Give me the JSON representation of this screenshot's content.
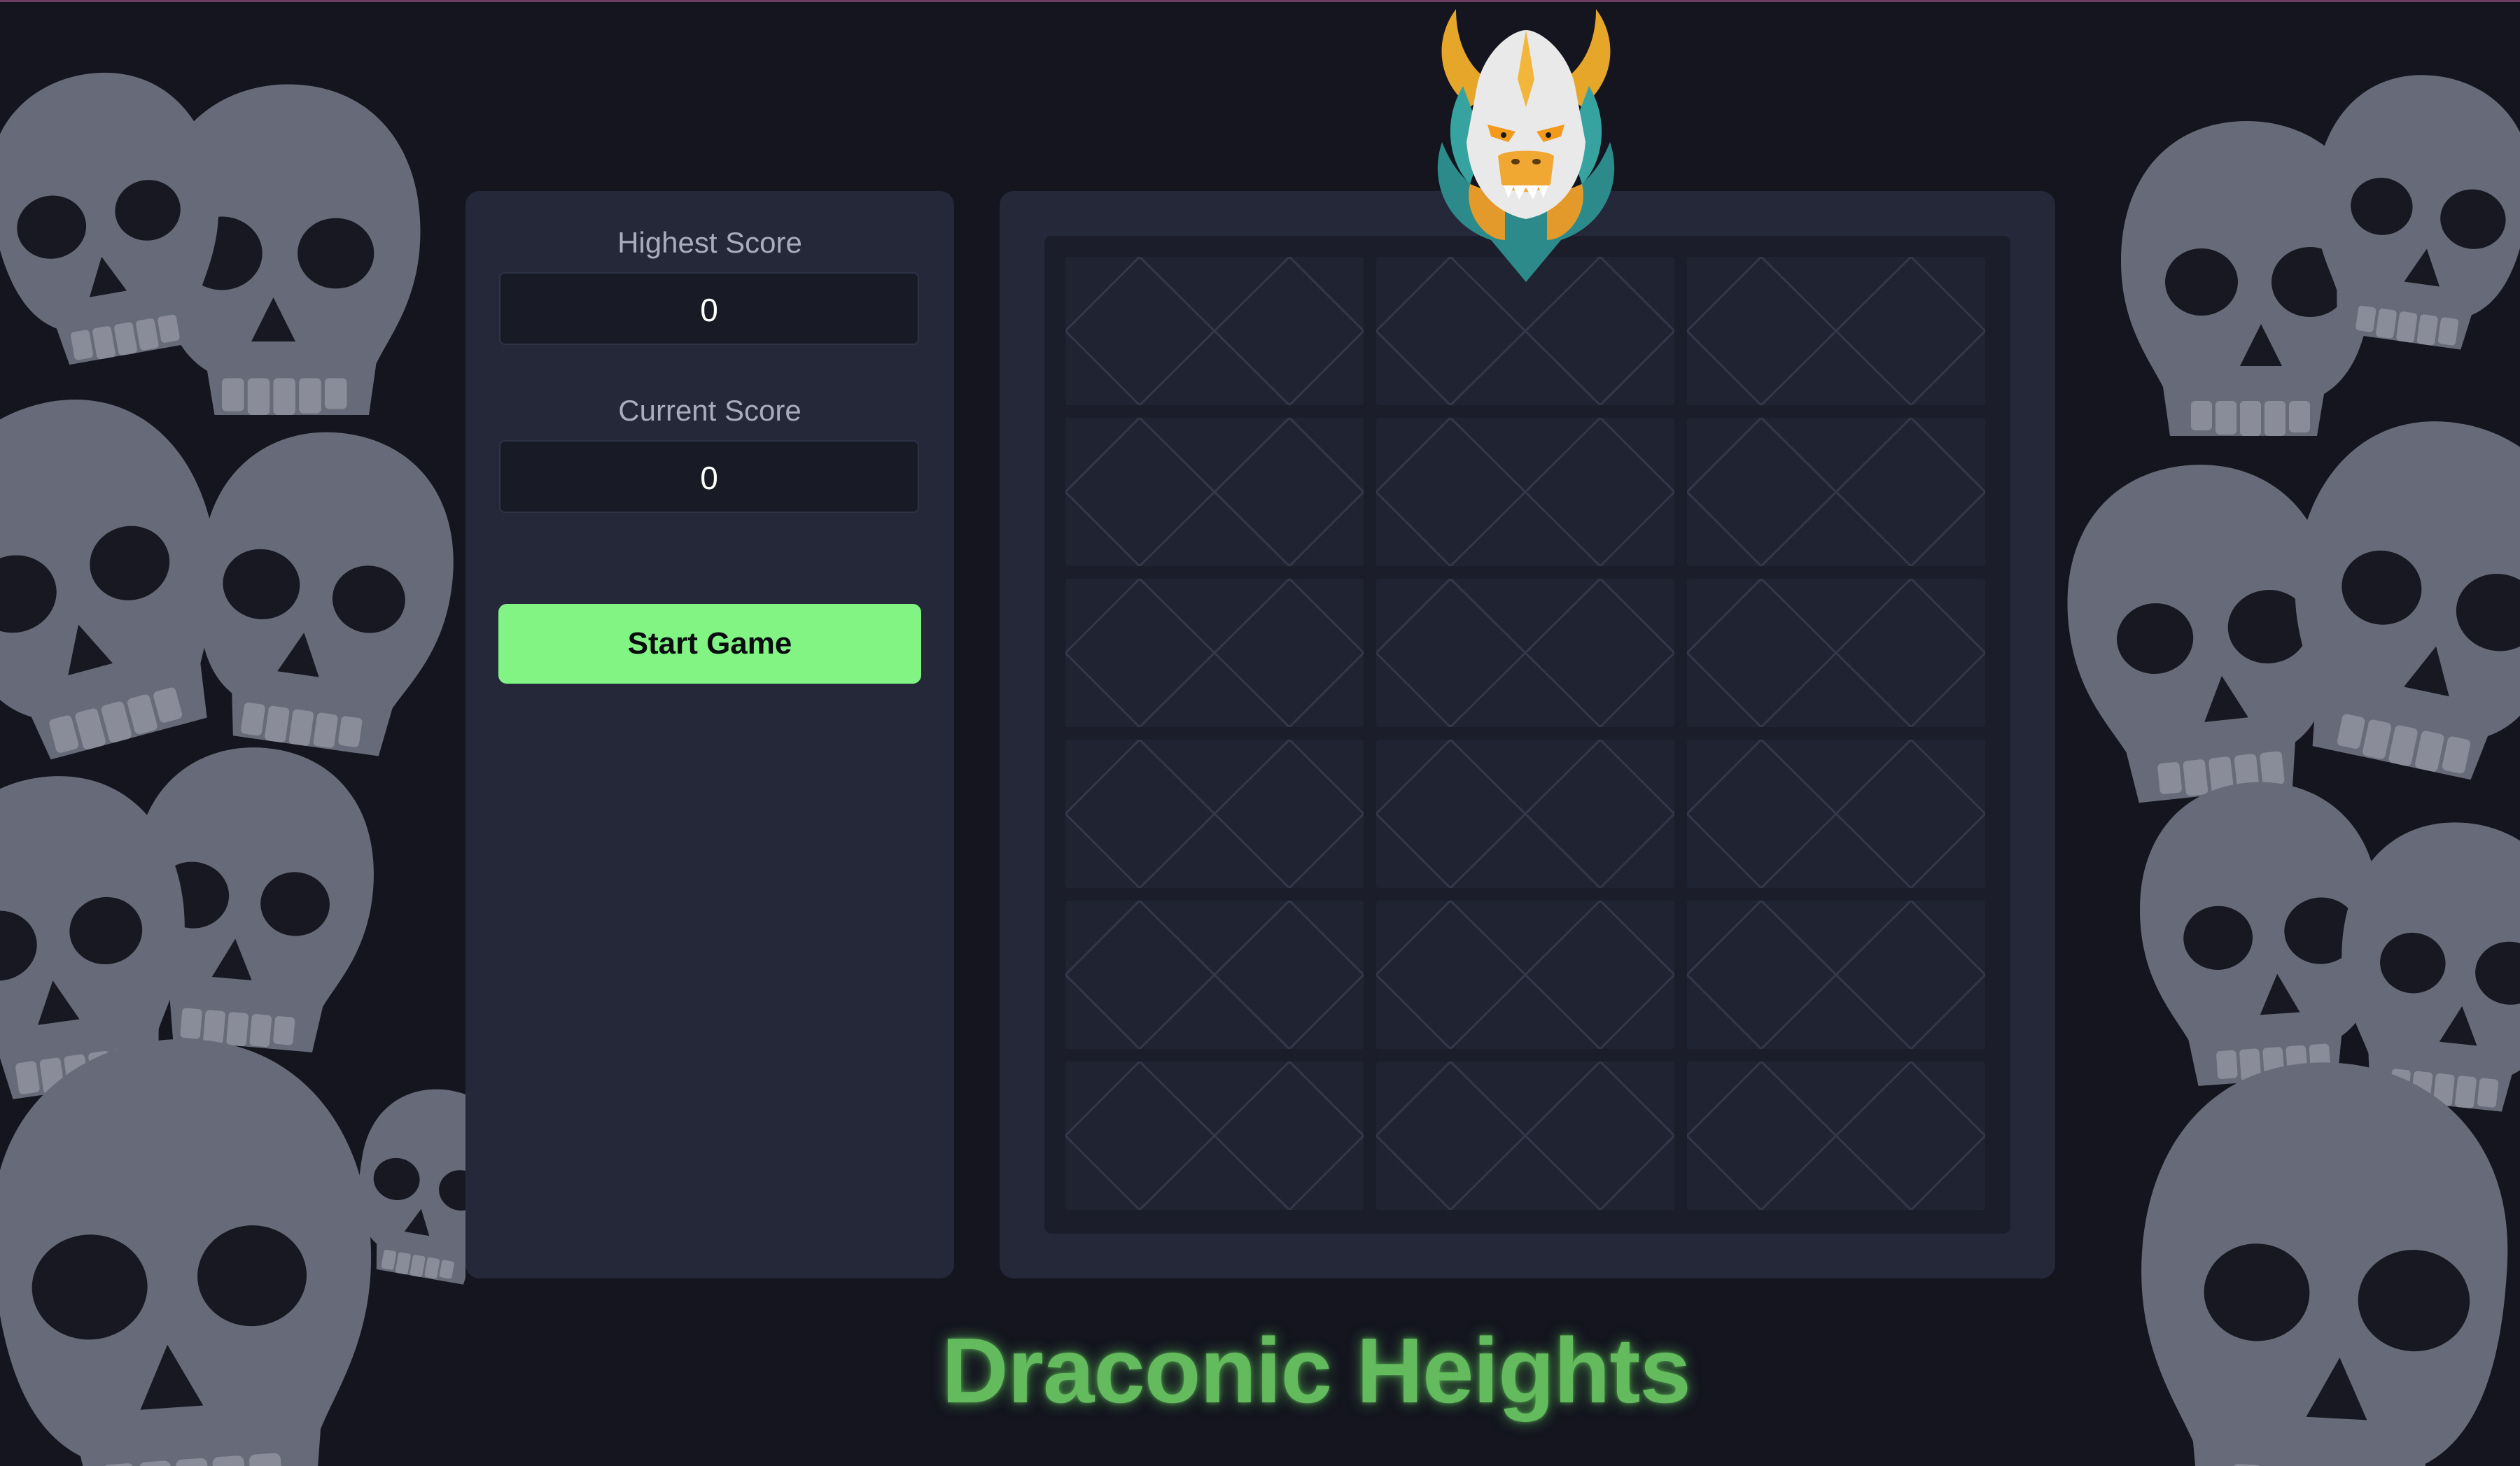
{
  "game": {
    "title": "Draconic Heights"
  },
  "scores": {
    "highest_label": "Highest Score",
    "highest_value": "0",
    "current_label": "Current Score",
    "current_value": "0"
  },
  "controls": {
    "start_label": "Start Game"
  },
  "board": {
    "rows": 6,
    "columns": 3,
    "tile_icon": "diamond-pattern-icon"
  },
  "decor": {
    "mascot_icon": "dragon-head-icon",
    "background_icon": "skull-pile-icon"
  },
  "colors": {
    "background": "#14151f",
    "panel": "#242839",
    "accent_green": "#82f484",
    "title_green": "#64bb5e"
  }
}
